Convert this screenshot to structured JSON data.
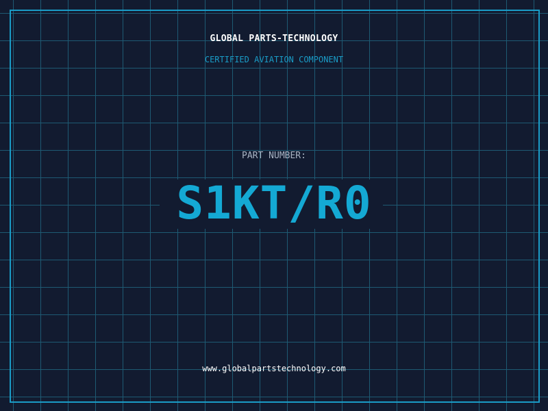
{
  "brand": "GLOBAL PARTS-TECHNOLOGY",
  "subtitle": "CERTIFIED AVIATION COMPONENT",
  "part_number_label": "PART NUMBER:",
  "part_number": "S1KT/R0",
  "website": "www.globalpartstechnology.com",
  "colors": {
    "background": "#121b30",
    "grid": "#1e5a73",
    "accent": "#14a9d4",
    "label": "#a9b4c4",
    "text": "#ffffff"
  }
}
